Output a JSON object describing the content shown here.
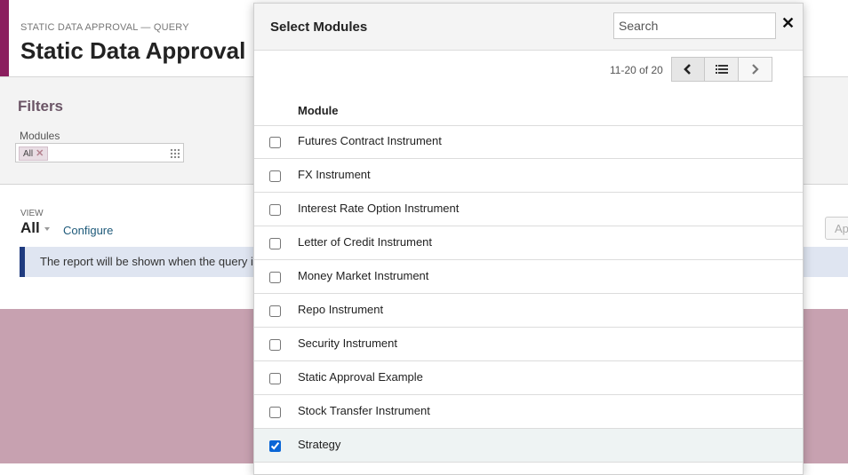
{
  "page": {
    "breadcrumb": "STATIC DATA APPROVAL — QUERY",
    "title": "Static Data Approval"
  },
  "filters": {
    "title": "Filters",
    "modules_label": "Modules",
    "chip_label": "All"
  },
  "view": {
    "label": "VIEW",
    "value": "All",
    "configure": "Configure",
    "apply_label": "Ap",
    "report_note": "The report will be shown when the query is run."
  },
  "modal": {
    "title": "Select Modules",
    "search_placeholder": "Search",
    "pager_text": "11-20 of 20",
    "column_header": "Module",
    "rows": [
      {
        "label": "Futures Contract Instrument",
        "checked": false
      },
      {
        "label": "FX Instrument",
        "checked": false
      },
      {
        "label": "Interest Rate Option Instrument",
        "checked": false
      },
      {
        "label": "Letter of Credit Instrument",
        "checked": false
      },
      {
        "label": "Money Market Instrument",
        "checked": false
      },
      {
        "label": "Repo Instrument",
        "checked": false
      },
      {
        "label": "Security Instrument",
        "checked": false
      },
      {
        "label": "Static Approval Example",
        "checked": false
      },
      {
        "label": "Stock Transfer Instrument",
        "checked": false
      },
      {
        "label": "Strategy",
        "checked": true
      }
    ]
  },
  "colors": {
    "brand": "#8b1e5e",
    "overlay": "#c7a1b0",
    "note_bar": "#1f3b7f",
    "checkbox_checked": "#0a66d6"
  },
  "icons": [
    "close-icon",
    "chevron-left-icon",
    "list-icon",
    "chevron-right-icon",
    "grid-icon",
    "remove-chip-icon",
    "caret-down-icon"
  ]
}
